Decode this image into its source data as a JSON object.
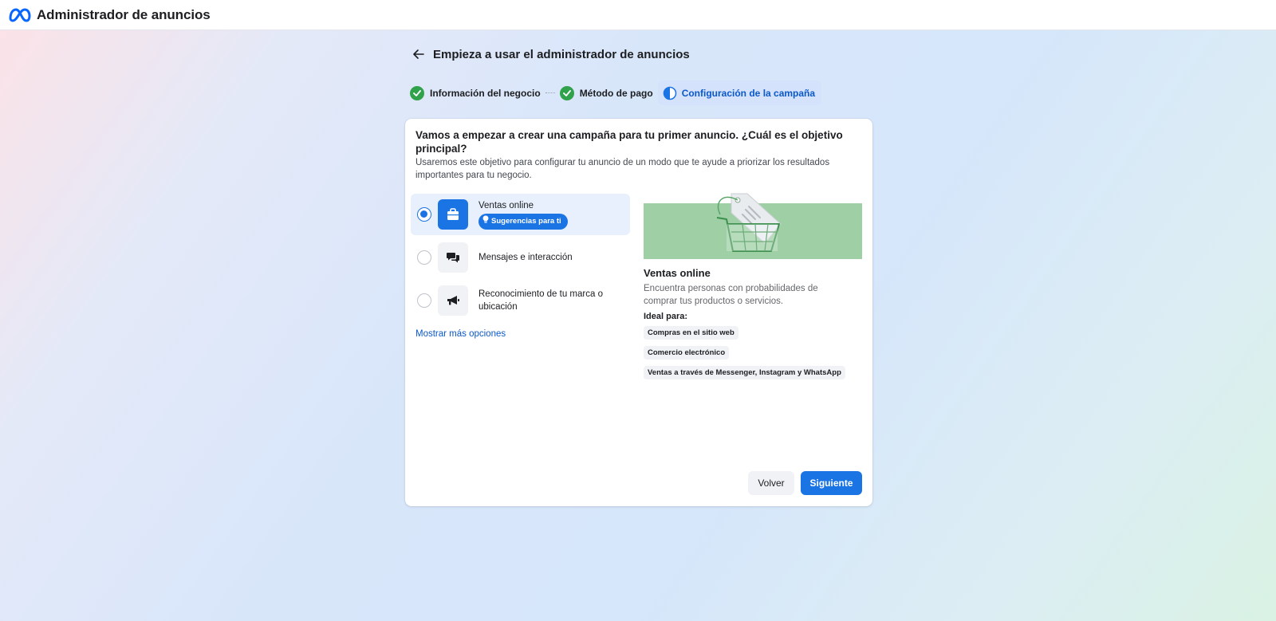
{
  "app": {
    "title": "Administrador de anuncios",
    "logo_icon": "meta-logo-icon",
    "brand_color": "#0866ff"
  },
  "header": {
    "back_icon": "arrow-left-icon",
    "title": "Empieza a usar el administrador de anuncios"
  },
  "steps": [
    {
      "label": "Información del negocio",
      "status": "complete",
      "icon": "check-circle-icon"
    },
    {
      "label": "Método de pago",
      "status": "complete",
      "icon": "check-circle-icon"
    },
    {
      "label": "Configuración de la campaña",
      "status": "in-progress",
      "icon": "half-circle-icon"
    }
  ],
  "card": {
    "title": "Vamos a empezar a crear una campaña para tu primer anuncio. ¿Cuál es el objetivo principal?",
    "description": "Usaremos este objetivo para configurar tu anuncio de un modo que te ayude a priorizar los resultados importantes para tu negocio.",
    "options": [
      {
        "label": "Ventas online",
        "icon": "shopping-bag-icon",
        "selected": true,
        "badge": "Sugerencias para ti",
        "badge_icon": "lightbulb-icon"
      },
      {
        "label": "Mensajes e interacción",
        "icon": "chat-bubbles-icon",
        "selected": false
      },
      {
        "label": "Reconocimiento de tu marca o ubicación",
        "icon": "megaphone-icon",
        "selected": false
      }
    ],
    "more_options": "Mostrar más opciones",
    "preview": {
      "image_icon": "shopping-cart-illustration",
      "title": "Ventas online",
      "description": "Encuentra personas con probabilidades de comprar tus productos o servicios.",
      "ideal_label": "Ideal para:",
      "tags": [
        "Compras en el sitio web",
        "Comercio electrónico",
        "Ventas a través de Messenger, Instagram y WhatsApp"
      ]
    },
    "buttons": {
      "back": "Volver",
      "next": "Siguiente"
    }
  },
  "colors": {
    "accent": "#1b74e4",
    "success": "#31a24c",
    "active_step_bg": "#d4e2fb",
    "illustration_green": "#9fd0a5"
  }
}
